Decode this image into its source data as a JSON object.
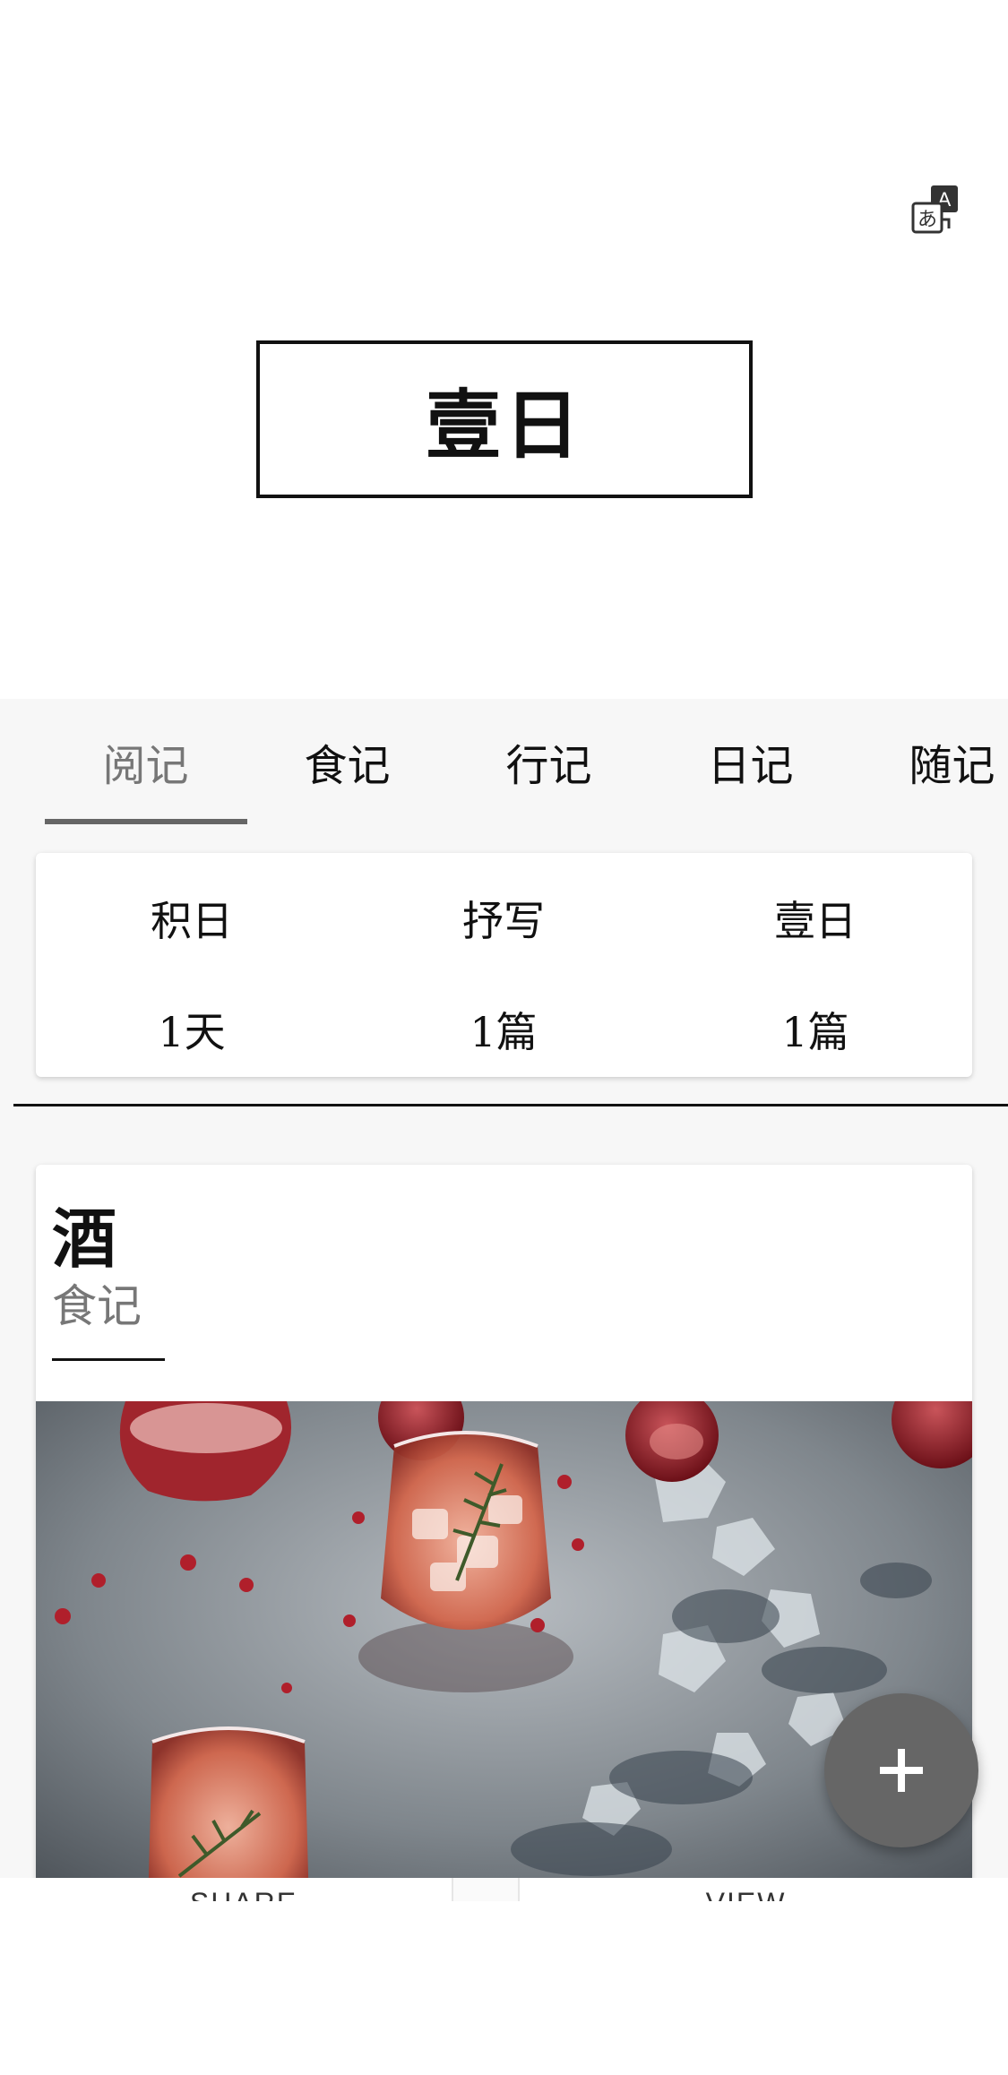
{
  "header": {
    "translate_icon": "translate-icon",
    "logo_text": "壹日"
  },
  "tabs": [
    {
      "label": "阅记",
      "active": true
    },
    {
      "label": "食记",
      "active": false
    },
    {
      "label": "行记",
      "active": false
    },
    {
      "label": "日记",
      "active": false
    },
    {
      "label": "随记",
      "active": false
    }
  ],
  "stats": [
    {
      "label": "积日",
      "value": "1天"
    },
    {
      "label": "抒写",
      "value": "1篇"
    },
    {
      "label": "壹日",
      "value": "1篇"
    }
  ],
  "entry": {
    "title": "酒",
    "category": "食记",
    "image_icon": "drinks-photo"
  },
  "actions": {
    "share_label": "SHARE",
    "view_label": "VIEW"
  },
  "fab": {
    "icon": "plus-icon"
  },
  "colors": {
    "accent_gray": "#666666",
    "muted_text": "#777777",
    "background": "#f7f7f7"
  }
}
